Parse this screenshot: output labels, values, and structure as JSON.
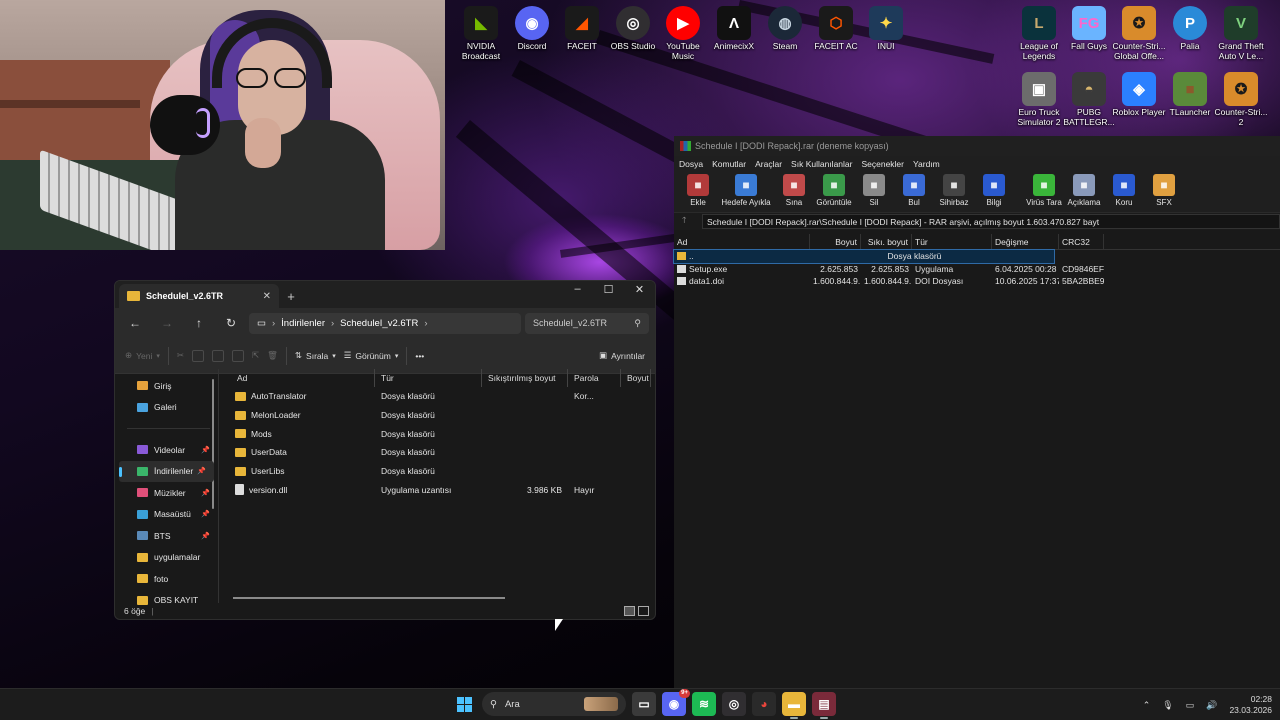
{
  "desktop": {
    "icons": [
      {
        "label": "NVIDIA Broadcast",
        "icon": "nvidia-broadcast-icon",
        "color": "#1a1a1a",
        "glyph": "◣",
        "fg": "#76b900"
      },
      {
        "label": "Discord",
        "icon": "discord-icon",
        "color": "#5865f2",
        "glyph": "◉",
        "fg": "#ffffff",
        "round": true
      },
      {
        "label": "FACEIT",
        "icon": "faceit-icon",
        "color": "#1a1a1a",
        "glyph": "◢",
        "fg": "#ff5500"
      },
      {
        "label": "OBS Studio",
        "icon": "obs-icon",
        "color": "#302e31",
        "glyph": "◎",
        "fg": "#ffffff",
        "round": true
      },
      {
        "label": "YouTube Music",
        "icon": "youtube-music-icon",
        "color": "#ff0000",
        "glyph": "▶",
        "fg": "#ffffff",
        "round": true
      },
      {
        "label": "AnimecixX",
        "icon": "animecix-icon",
        "color": "#111111",
        "glyph": "Λ",
        "fg": "#ffffff"
      },
      {
        "label": "Steam",
        "icon": "steam-icon",
        "color": "#1b2838",
        "glyph": "◍",
        "fg": "#c7d5e0",
        "round": true
      },
      {
        "label": "FACEIT AC",
        "icon": "faceit-ac-icon",
        "color": "#1a1a1a",
        "glyph": "⬡",
        "fg": "#ff5500"
      },
      {
        "label": "INUI",
        "icon": "inui-icon",
        "color": "#1e3a5a",
        "glyph": "✦",
        "fg": "#ffd84a"
      }
    ],
    "game_icons": [
      {
        "label": "League of Legends",
        "icon": "league-of-legends-icon",
        "color": "#0a323c",
        "glyph": "L",
        "fg": "#c8aa6e"
      },
      {
        "label": "Fall Guys",
        "icon": "fall-guys-icon",
        "color": "#6ab4ff",
        "glyph": "FG",
        "fg": "#ff66cc"
      },
      {
        "label": "Counter-Stri... Global Offe...",
        "icon": "csgo-icon",
        "color": "#d98b2b",
        "glyph": "✪",
        "fg": "#1a1a1a"
      },
      {
        "label": "Palia",
        "icon": "palia-icon",
        "color": "#2a8ad8",
        "glyph": "P",
        "fg": "#ffffff",
        "round": true
      },
      {
        "label": "Grand Theft Auto V Le...",
        "icon": "gta-v-icon",
        "color": "#1f3d2a",
        "glyph": "V",
        "fg": "#7fd17f"
      },
      {
        "label": "Euro Truck Simulator 2",
        "icon": "euro-truck-icon",
        "color": "#6c6c6c",
        "glyph": "▣",
        "fg": "#ffffff"
      },
      {
        "label": "PUBG BATTLEGR...",
        "icon": "pubg-icon",
        "color": "#3a3a3a",
        "glyph": "◓",
        "fg": "#d7b56d"
      },
      {
        "label": "Roblox Player",
        "icon": "roblox-icon",
        "color": "#2b80ff",
        "glyph": "◈",
        "fg": "#ffffff"
      },
      {
        "label": "TLauncher",
        "icon": "tlauncher-icon",
        "color": "#5a8a3a",
        "glyph": "■",
        "fg": "#8b5a2b"
      },
      {
        "label": "Counter-Stri... 2",
        "icon": "cs2-icon",
        "color": "#d98b2b",
        "glyph": "✪",
        "fg": "#1a1a1a"
      }
    ]
  },
  "winrar": {
    "title": "Schedule I [DODI Repack].rar (deneme kopyası)",
    "menu": [
      "Dosya",
      "Komutlar",
      "Araçlar",
      "Sık Kullanılanlar",
      "Seçenekler",
      "Yardım"
    ],
    "toolbar": [
      {
        "label": "Ekle",
        "icon": "add-icon",
        "color": "#b23a3a"
      },
      {
        "label": "Hedefe Ayıkla",
        "icon": "extract-folder-icon",
        "color": "#3a7bd5",
        "wide": true
      },
      {
        "label": "Sına",
        "icon": "test-icon",
        "color": "#c04a4a"
      },
      {
        "label": "Görüntüle",
        "icon": "view-book-icon",
        "color": "#3a9a4a"
      },
      {
        "label": "Sil",
        "icon": "delete-bin-icon",
        "color": "#8a8a8a"
      },
      {
        "label": "Bul",
        "icon": "find-icon",
        "color": "#3a6ad5"
      },
      {
        "label": "Sihirbaz",
        "icon": "wizard-icon",
        "color": "#444444"
      },
      {
        "label": "Bilgi",
        "icon": "info-icon",
        "color": "#2a5ad0"
      },
      {
        "label": "Virüs Tara",
        "icon": "virus-scan-icon",
        "color": "#3ab53a"
      },
      {
        "label": "Açıklama",
        "icon": "comment-icon",
        "color": "#8a9aba"
      },
      {
        "label": "Koru",
        "icon": "shield-icon",
        "color": "#2a5ad0"
      },
      {
        "label": "SFX",
        "icon": "sfx-icon",
        "color": "#e0a040"
      }
    ],
    "path": "Schedule I [DODI Repack].rar\\Schedule I [DODI Repack] - RAR arşivi, açılmış boyut 1.603.470.827 bayt",
    "columns": [
      "Ad",
      "Boyut",
      "Sıkı. boyut",
      "Tür",
      "Değişme",
      "CRC32"
    ],
    "rows": [
      {
        "name": "..",
        "size": "",
        "packed": "",
        "type": "Dosya klasörü",
        "modified": "",
        "crc": "",
        "selected": true,
        "kind": "folder"
      },
      {
        "name": "Setup.exe",
        "size": "2.625.853",
        "packed": "2.625.853",
        "type": "Uygulama",
        "modified": "6.04.2025 00:28",
        "crc": "CD9846EF",
        "kind": "exe"
      },
      {
        "name": "data1.doi",
        "size": "1.600.844.9...",
        "packed": "1.600.844.9...",
        "type": "DOI Dosyası",
        "modified": "10.06.2025 17:37",
        "crc": "5BA2BBE9",
        "kind": "file"
      }
    ]
  },
  "explorer": {
    "tab_title": "ScheduleI_v2.6TR",
    "breadcrumb": [
      "İndirilenler",
      "ScheduleI_v2.6TR"
    ],
    "search_placeholder": "ScheduleI_v2.6TR",
    "commands": {
      "new": "Yeni",
      "sort": "Sırala",
      "view": "Görünüm",
      "more": "•••",
      "details": "Ayrıntılar"
    },
    "nav": [
      {
        "label": "Giriş",
        "icon": "home-icon",
        "color": "#e6a23c"
      },
      {
        "label": "Galeri",
        "icon": "gallery-icon",
        "color": "#4aa3df"
      },
      {
        "sep": true
      },
      {
        "label": "Videolar",
        "icon": "videos-icon",
        "color": "#8a5ad8",
        "pinned": true
      },
      {
        "label": "İndirilenler",
        "icon": "downloads-icon",
        "color": "#3ab56a",
        "pinned": true,
        "selected": true
      },
      {
        "label": "Müzikler",
        "icon": "music-icon",
        "color": "#e0507a",
        "pinned": true
      },
      {
        "label": "Masaüstü",
        "icon": "desktop-icon",
        "color": "#3aa0d8",
        "pinned": true
      },
      {
        "label": "BTS",
        "icon": "bts-folder-icon",
        "color": "#5a8ab8",
        "pinned": true
      },
      {
        "label": "uygulamalar",
        "icon": "folder-icon",
        "color": "#e8b63a"
      },
      {
        "label": "foto",
        "icon": "folder-icon",
        "color": "#e8b63a"
      },
      {
        "label": "OBS KAYIT",
        "icon": "folder-icon",
        "color": "#e8b63a"
      }
    ],
    "columns": [
      "Ad",
      "Tür",
      "Sıkıştırılmış boyut",
      "Parola Kor...",
      "Boyut"
    ],
    "files": [
      {
        "name": "AutoTranslator",
        "type": "Dosya klasörü",
        "csize": "",
        "pw": "",
        "kind": "folder"
      },
      {
        "name": "MelonLoader",
        "type": "Dosya klasörü",
        "csize": "",
        "pw": "",
        "kind": "folder"
      },
      {
        "name": "Mods",
        "type": "Dosya klasörü",
        "csize": "",
        "pw": "",
        "kind": "folder"
      },
      {
        "name": "UserData",
        "type": "Dosya klasörü",
        "csize": "",
        "pw": "",
        "kind": "folder"
      },
      {
        "name": "UserLibs",
        "type": "Dosya klasörü",
        "csize": "",
        "pw": "",
        "kind": "folder"
      },
      {
        "name": "version.dll",
        "type": "Uygulama uzantısı",
        "csize": "3.986 KB",
        "pw": "Hayır",
        "kind": "file"
      }
    ],
    "status": "6 öğe"
  },
  "taskbar": {
    "search_label": "Ara",
    "apps": [
      {
        "icon": "task-view-icon",
        "color": "#3a3a3a",
        "glyph": "▭"
      },
      {
        "icon": "discord-taskbar-icon",
        "color": "#5865f2",
        "glyph": "◉",
        "badge": "9+"
      },
      {
        "icon": "spotify-icon",
        "color": "#1db954",
        "glyph": "≋"
      },
      {
        "icon": "obs-taskbar-icon",
        "color": "#302e31",
        "glyph": "◎"
      },
      {
        "icon": "chrome-icon",
        "color": "#2a2a2a",
        "glyph": "◕"
      },
      {
        "icon": "file-explorer-icon",
        "color": "#e8b63a",
        "glyph": "▬",
        "active": true
      },
      {
        "icon": "winrar-taskbar-icon",
        "color": "#7a2a3a",
        "glyph": "▤",
        "active": true
      }
    ],
    "time": "02:28",
    "date": "23.03.2026"
  }
}
